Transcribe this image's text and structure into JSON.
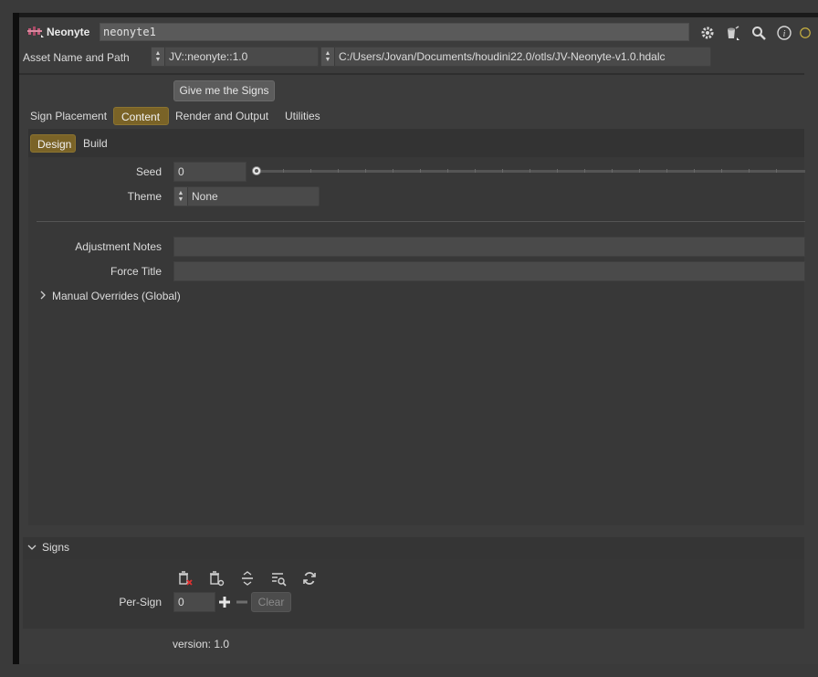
{
  "header": {
    "node_type": "Neonyte",
    "node_name": "neonyte1",
    "icons": [
      "gear-icon",
      "paint-bucket-icon",
      "search-icon",
      "info-icon",
      "help-icon"
    ]
  },
  "asset": {
    "label": "Asset Name and Path",
    "name_value": "JV::neonyte::1.0",
    "path_value": "C:/Users/Jovan/Documents/houdini22.0/otls/JV-Neonyte-v1.0.hdalc"
  },
  "action_button": "Give me the Signs",
  "tabs": [
    {
      "label": "Sign Placement",
      "active": false
    },
    {
      "label": "Content",
      "active": true
    },
    {
      "label": "Render and Output",
      "active": false
    },
    {
      "label": "Utilities",
      "active": false
    }
  ],
  "subtabs": [
    {
      "label": "Design",
      "active": true
    },
    {
      "label": "Build",
      "active": false
    }
  ],
  "design": {
    "seed_label": "Seed",
    "seed_value": "0",
    "theme_label": "Theme",
    "theme_value": "None",
    "adjustment_notes_label": "Adjustment Notes",
    "adjustment_notes_value": "",
    "force_title_label": "Force Title",
    "force_title_value": "",
    "manual_overrides_label": "Manual Overrides (Global)"
  },
  "signs": {
    "section_label": "Signs",
    "toolbar_icons": [
      "delete-all-icon",
      "delete-instance-icon",
      "collapse-icon",
      "search-list-icon",
      "refresh-icon"
    ],
    "per_sign_label": "Per-Sign",
    "per_sign_value": "0",
    "clear_label": "Clear"
  },
  "footer": {
    "version": "version: 1.0"
  },
  "colors": {
    "accent": "#7a6327",
    "background": "#3c3c3c"
  }
}
